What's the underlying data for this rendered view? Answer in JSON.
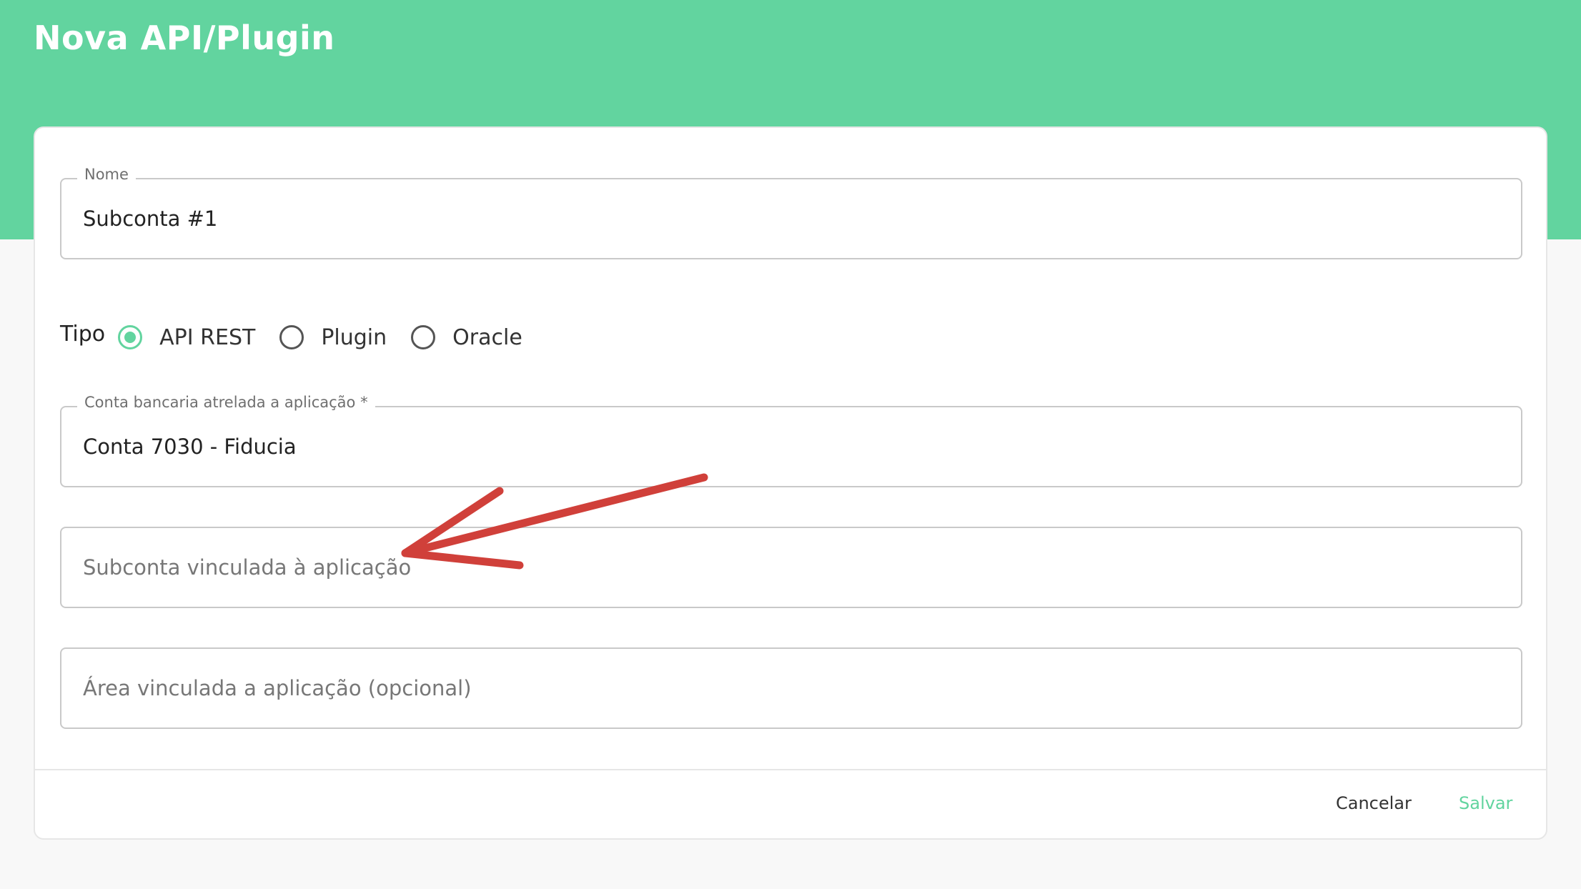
{
  "page": {
    "title": "Nova API/Plugin"
  },
  "form": {
    "nome": {
      "label": "Nome",
      "value": "Subconta #1"
    },
    "tipo": {
      "label": "Tipo",
      "options": [
        "API REST",
        "Plugin",
        "Oracle"
      ],
      "selected": "API REST"
    },
    "conta": {
      "label": "Conta bancaria atrelada a aplicação *",
      "value": "Conta 7030 - Fiducia"
    },
    "subconta": {
      "placeholder": "Subconta vinculada à aplicação"
    },
    "area": {
      "placeholder": "Área vinculada a aplicação (opcional)"
    }
  },
  "actions": {
    "cancel_label": "Cancelar",
    "save_label": "Salvar"
  },
  "colors": {
    "brand": "#62d49f",
    "annotation_arrow": "#d0403a"
  },
  "icons": {
    "annotation": "arrow-annotation-icon",
    "radio": "radio-icon"
  }
}
